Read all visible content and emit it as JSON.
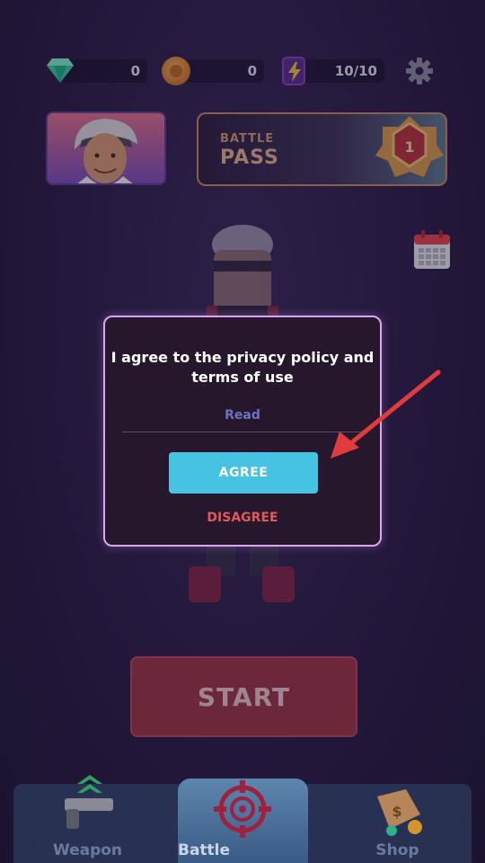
{
  "currencies": {
    "gems": "0",
    "coins": "0",
    "energy": "10/10"
  },
  "battle_pass": {
    "label_top": "BATTLE",
    "label_bottom": "PASS",
    "level": "1"
  },
  "dialog": {
    "message": "I agree to the privacy policy and terms of use",
    "read_link": "Read",
    "agree_label": "AGREE",
    "disagree_label": "DISAGREE"
  },
  "start_label": "START",
  "nav": {
    "weapon": "Weapon",
    "battle": "Battle",
    "shop": "Shop"
  },
  "colors": {
    "accent": "#46c3e3",
    "disagree": "#e05a5a",
    "modal_border": "#d9a6ef",
    "annotation_arrow": "#e23b3b"
  }
}
